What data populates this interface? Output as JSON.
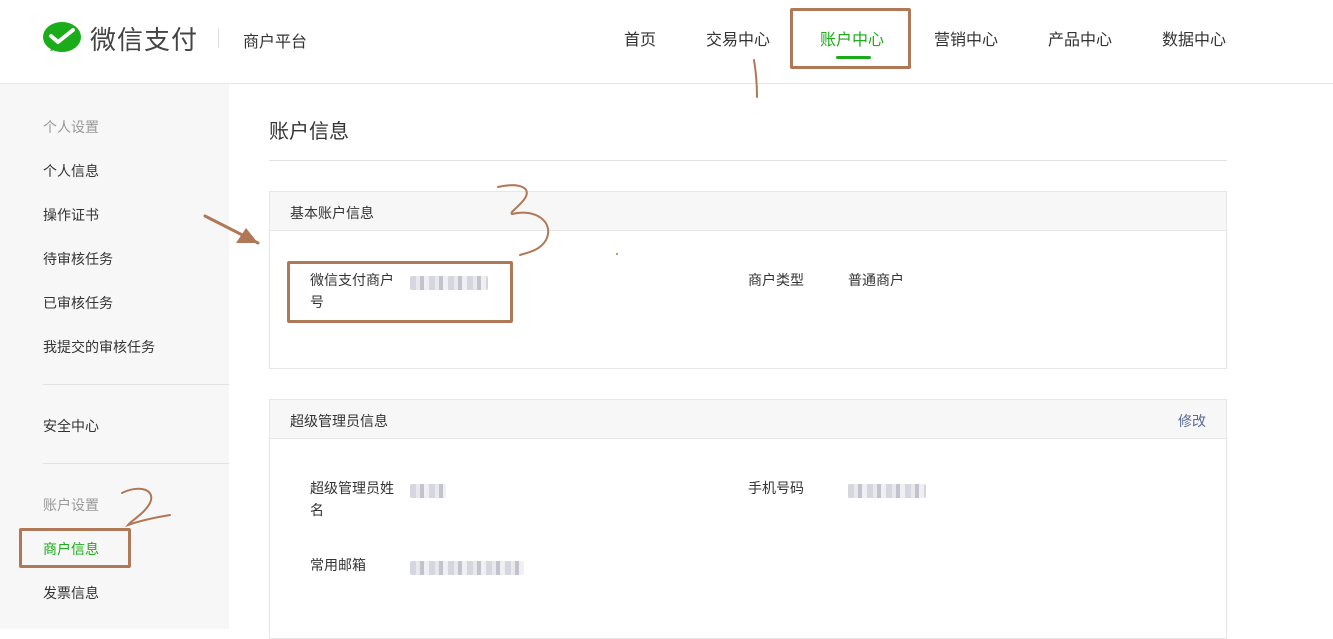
{
  "header": {
    "brand": "微信支付",
    "platform": "商户平台",
    "nav": [
      {
        "label": "首页",
        "active": false
      },
      {
        "label": "交易中心",
        "active": false
      },
      {
        "label": "账户中心",
        "active": true
      },
      {
        "label": "营销中心",
        "active": false
      },
      {
        "label": "产品中心",
        "active": false
      },
      {
        "label": "数据中心",
        "active": false
      }
    ]
  },
  "sidebar": {
    "group1": "个人设置",
    "items1": [
      "个人信息",
      "操作证书",
      "待审核任务",
      "已审核任务",
      "我提交的审核任务"
    ],
    "security": "安全中心",
    "group2": "账户设置",
    "items2": [
      {
        "label": "商户信息",
        "active": true
      },
      {
        "label": "发票信息",
        "active": false
      }
    ]
  },
  "main": {
    "title": "账户信息",
    "basic": {
      "title": "基本账户信息",
      "merchant_id_label": "微信支付商户号",
      "merchant_type_label": "商户类型",
      "merchant_type_value": "普通商户"
    },
    "admin": {
      "title": "超级管理员信息",
      "edit_label": "修改",
      "name_label": "超级管理员姓名",
      "phone_label": "手机号码",
      "email_label": "常用邮箱"
    }
  },
  "annotations": {
    "color": "#b07856",
    "numbers": [
      "2",
      "3"
    ]
  },
  "colors": {
    "accent": "#1aad19",
    "link": "#576b95"
  }
}
